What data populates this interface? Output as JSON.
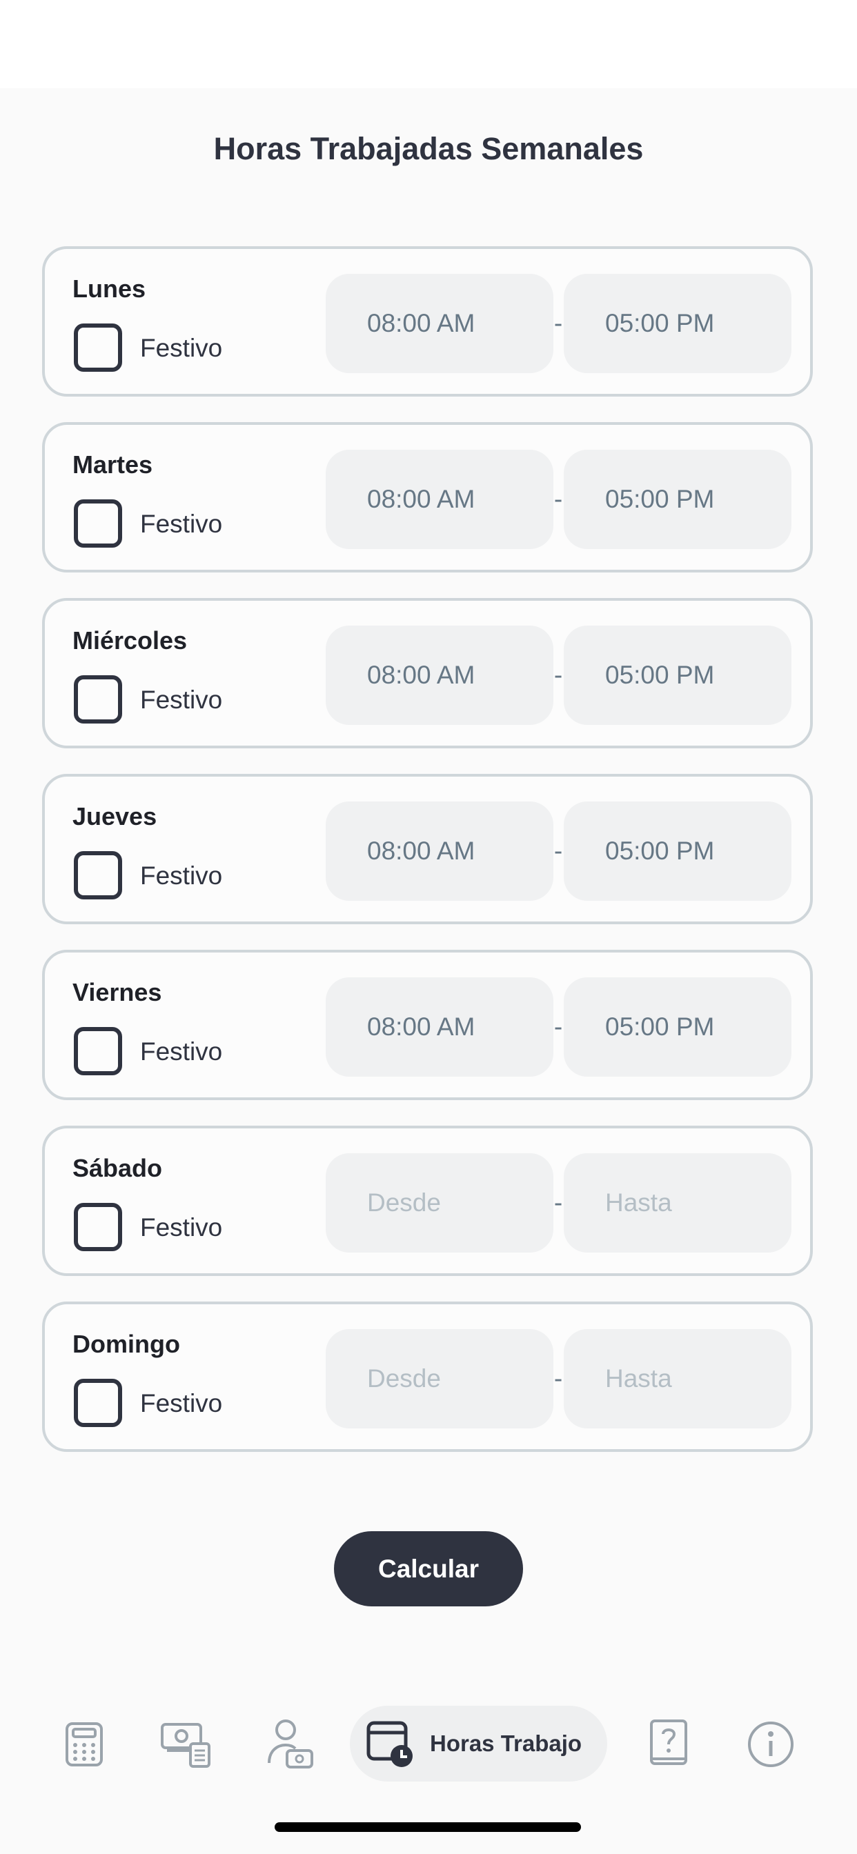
{
  "header": {
    "title": "Horas Trabajadas Semanales"
  },
  "days": [
    {
      "name": "Lunes",
      "festivo_label": "Festivo",
      "festivo_checked": false,
      "from": "08:00 AM",
      "to": "05:00 PM",
      "separator": "-"
    },
    {
      "name": "Martes",
      "festivo_label": "Festivo",
      "festivo_checked": false,
      "from": "08:00 AM",
      "to": "05:00 PM",
      "separator": "-"
    },
    {
      "name": "Miércoles",
      "festivo_label": "Festivo",
      "festivo_checked": false,
      "from": "08:00 AM",
      "to": "05:00 PM",
      "separator": "-"
    },
    {
      "name": "Jueves",
      "festivo_label": "Festivo",
      "festivo_checked": false,
      "from": "08:00 AM",
      "to": "05:00 PM",
      "separator": "-"
    },
    {
      "name": "Viernes",
      "festivo_label": "Festivo",
      "festivo_checked": false,
      "from": "08:00 AM",
      "to": "05:00 PM",
      "separator": "-"
    },
    {
      "name": "Sábado",
      "festivo_label": "Festivo",
      "festivo_checked": false,
      "from": "",
      "to": "",
      "from_placeholder": "Desde",
      "to_placeholder": "Hasta",
      "separator": "-"
    },
    {
      "name": "Domingo",
      "festivo_label": "Festivo",
      "festivo_checked": false,
      "from": "",
      "to": "",
      "from_placeholder": "Desde",
      "to_placeholder": "Hasta",
      "separator": "-"
    }
  ],
  "actions": {
    "calculate_label": "Calcular"
  },
  "nav": {
    "items": [
      {
        "icon": "calculator-icon"
      },
      {
        "icon": "money-calculator-icon"
      },
      {
        "icon": "user-money-icon"
      },
      {
        "icon": "calendar-clock-icon",
        "label": "Horas Trabajo",
        "active": true
      },
      {
        "icon": "help-book-icon"
      },
      {
        "icon": "info-icon"
      }
    ]
  },
  "colors": {
    "primary": "#2f3340",
    "card_border": "#cfd6da",
    "field_bg": "#f0f1f2",
    "field_text": "#667785",
    "placeholder": "#b4bec5",
    "inactive_icon": "#9aa3ab"
  }
}
